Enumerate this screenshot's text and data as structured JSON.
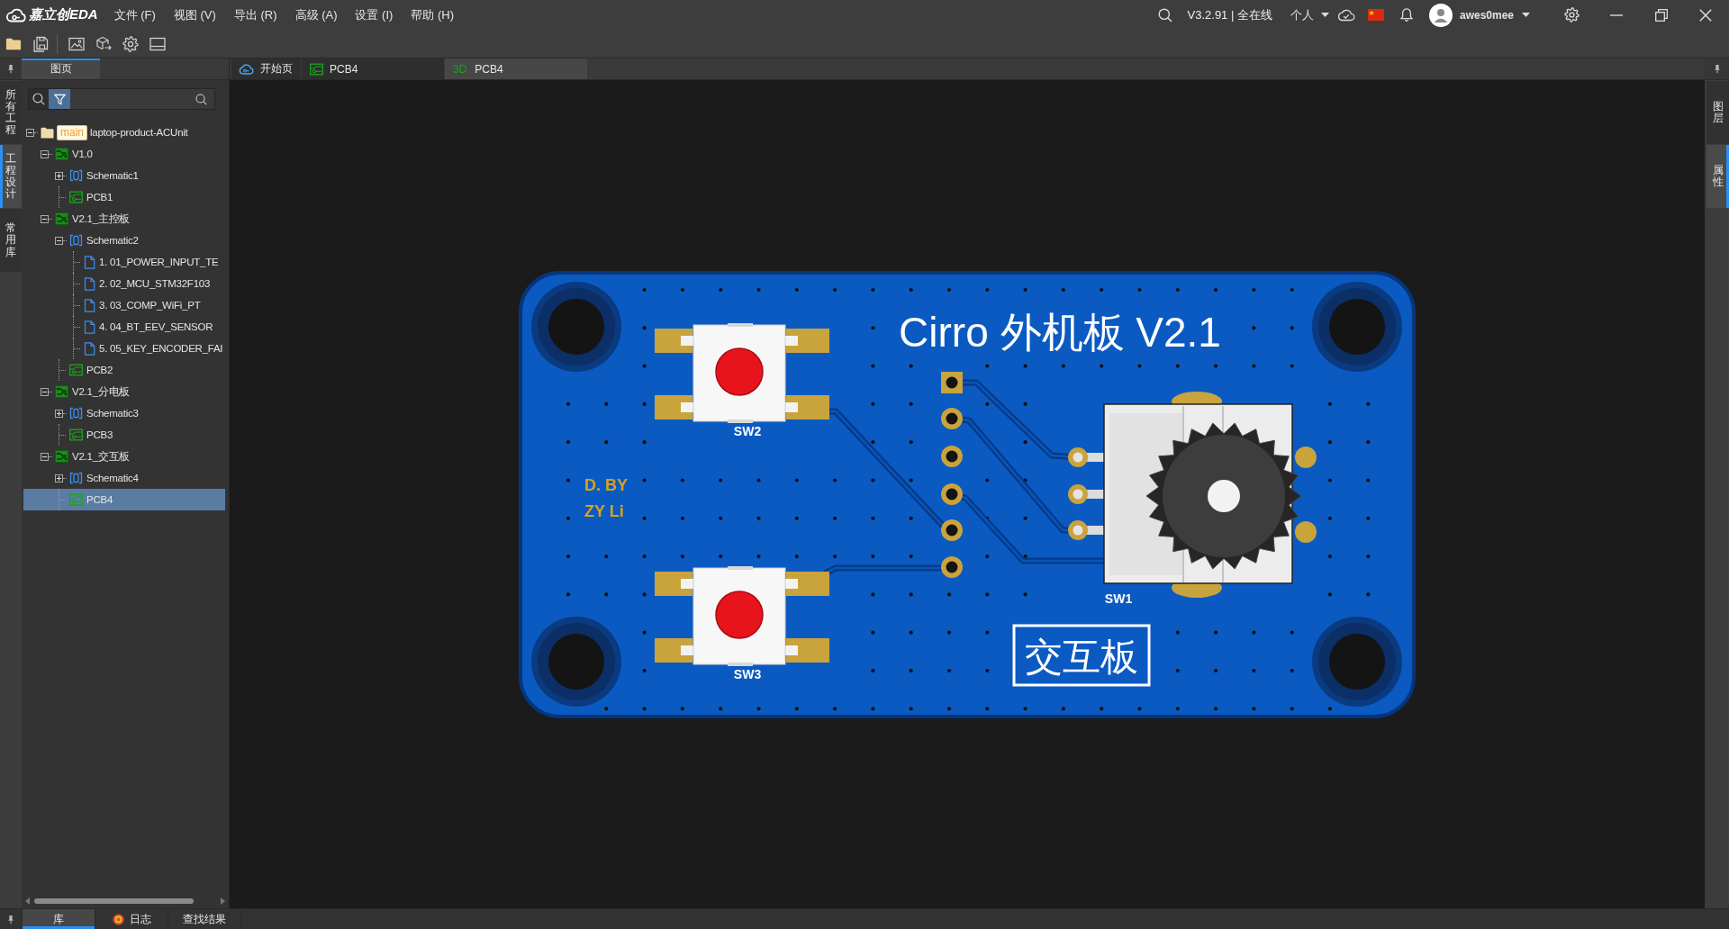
{
  "title_bar": {
    "logo_text": "嘉立创EDA",
    "menu": [
      "文件 (F)",
      "视图 (V)",
      "导出 (R)",
      "高级 (A)",
      "设置 (I)",
      "帮助 (H)"
    ],
    "version": "V3.2.91 | 全在线",
    "workspace": "个人",
    "username": "awes0mee"
  },
  "left_rail": {
    "tabs": [
      {
        "label": "所有工程",
        "selected": false
      },
      {
        "label": "工程设计",
        "selected": true
      },
      {
        "label": "常用库",
        "selected": false
      }
    ]
  },
  "panel": {
    "tabs": [
      {
        "label": "图页",
        "selected": true
      }
    ],
    "tree": [
      {
        "kind": "project",
        "label": "laptop-product-ACUnit",
        "badge": "main",
        "expanded": true,
        "selected": false,
        "children": [
          {
            "kind": "board",
            "label": "V1.0",
            "expanded": true,
            "selected": false,
            "children": [
              {
                "kind": "schematic",
                "label": "Schematic1",
                "expanded": false,
                "selected": false
              },
              {
                "kind": "pcb",
                "label": "PCB1",
                "selected": false
              }
            ]
          },
          {
            "kind": "board",
            "label": "V2.1_主控板",
            "expanded": true,
            "selected": false,
            "children": [
              {
                "kind": "schematic",
                "label": "Schematic2",
                "expanded": true,
                "selected": false,
                "children": [
                  {
                    "kind": "sheet",
                    "label": "1. 01_POWER_INPUT_TE",
                    "selected": false
                  },
                  {
                    "kind": "sheet",
                    "label": "2. 02_MCU_STM32F103",
                    "selected": false
                  },
                  {
                    "kind": "sheet",
                    "label": "3. 03_COMP_WiFi_PT",
                    "selected": false
                  },
                  {
                    "kind": "sheet",
                    "label": "4. 04_BT_EEV_SENSOR",
                    "selected": false
                  },
                  {
                    "kind": "sheet",
                    "label": "5. 05_KEY_ENCODER_FAI",
                    "selected": false
                  }
                ]
              },
              {
                "kind": "pcb",
                "label": "PCB2",
                "selected": false
              }
            ]
          },
          {
            "kind": "board",
            "label": "V2.1_分电板",
            "expanded": true,
            "selected": false,
            "children": [
              {
                "kind": "schematic",
                "label": "Schematic3",
                "expanded": false,
                "selected": false
              },
              {
                "kind": "pcb",
                "label": "PCB3",
                "selected": false
              }
            ]
          },
          {
            "kind": "board",
            "label": "V2.1_交互板",
            "expanded": true,
            "selected": false,
            "children": [
              {
                "kind": "schematic",
                "label": "Schematic4",
                "expanded": false,
                "selected": false
              },
              {
                "kind": "pcb",
                "label": "PCB4",
                "selected": true
              }
            ]
          }
        ]
      }
    ]
  },
  "document_tabs": [
    {
      "kind": "start",
      "label": "开始页",
      "selected": false
    },
    {
      "kind": "pcb",
      "label": "PCB4",
      "selected": false
    },
    {
      "kind": "model",
      "badge": "3D",
      "label": "PCB4",
      "selected": true
    }
  ],
  "board": {
    "title": "Cirro 外机板 V2.1",
    "credit": [
      "D. BY",
      "ZY Li"
    ],
    "switches": [
      {
        "label": "SW2"
      },
      {
        "label": "SW3"
      }
    ],
    "encoder": {
      "label": "SW1"
    },
    "label": "交互板"
  },
  "right_rail": {
    "tabs": [
      {
        "label": "图层",
        "selected": false
      },
      {
        "label": "属性",
        "selected": true
      }
    ]
  },
  "bottom_tabs": [
    {
      "label": "库",
      "selected": true,
      "alert": false
    },
    {
      "label": "日志",
      "selected": false,
      "alert": true
    },
    {
      "label": "查找结果",
      "selected": false,
      "alert": false
    }
  ]
}
